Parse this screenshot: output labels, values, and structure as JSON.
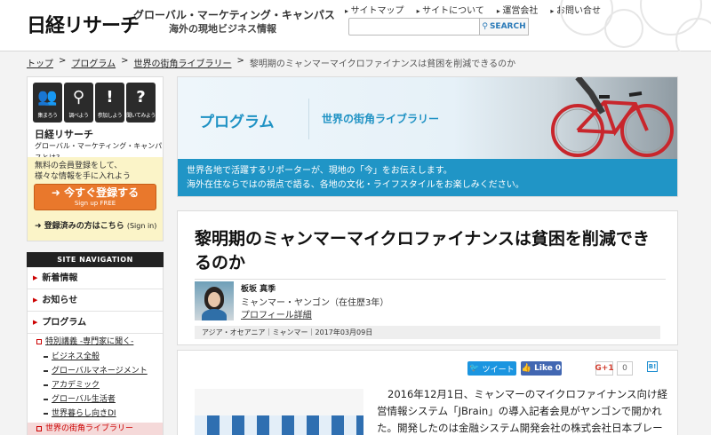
{
  "header": {
    "logo": "日経リサーチ",
    "tagline": "グローバル・マーケティング・キャンパス",
    "tagline_sub": "海外の現地ビジネス情報",
    "links": [
      "サイトマップ",
      "サイトについて",
      "運営会社",
      "お問い合せ"
    ],
    "search_placeholder": "",
    "search_button": "SEARCH"
  },
  "breadcrumb": [
    "トップ",
    "プログラム",
    "世界の街角ライブラリー",
    "黎明期のミャンマーマイクロファイナンスは貧困を削減できるのか"
  ],
  "sidebar": {
    "icons": [
      {
        "label": "集まろう",
        "glyph": "👥",
        "icon": "people-icon"
      },
      {
        "label": "調べよう",
        "glyph": "⚲",
        "icon": "magnifier-icon"
      },
      {
        "label": "参加しよう",
        "glyph": "!",
        "icon": "exclamation-icon"
      },
      {
        "label": "聞いてみよう",
        "glyph": "?",
        "icon": "question-icon"
      }
    ],
    "brand": "日経リサーチ",
    "brand_sub": "グローバル・マーケティング・キャンパスとは?",
    "note_line1": "無料の会員登録をして、",
    "note_line2": "様々な情報を手に入れよう",
    "register_label": "今すぐ登録する",
    "register_sub": "Sign up FREE",
    "signin": "登録済みの方はこちら",
    "signin_en": "(Sign in)"
  },
  "nav": {
    "header": "SITE NAVIGATION",
    "items": [
      "新着情報",
      "お知らせ",
      "プログラム"
    ],
    "sub": "特別講義 -専門家に聞く-",
    "sub_items": [
      "ビジネス全般",
      "グローバルマネージメント",
      "アカデミック",
      "グローバル生活者",
      "世界暮らし向きDI"
    ],
    "active": "世界の街角ライブラリー"
  },
  "banner": {
    "program": "プログラム",
    "library": "世界の街角ライブラリー",
    "desc_line1": "世界各地で活躍するリポーターが、現地の「今」をお伝えします。",
    "desc_line2": "海外在住ならではの視点で語る、各地の文化・ライフスタイルをお楽しみください。"
  },
  "article": {
    "title": "黎明期のミャンマーマイクロファイナンスは貧困を削減できるのか",
    "author": "板坂 真季",
    "location": "ミャンマー・ヤンゴン（在住歴3年）",
    "profile_link": "プロフィール詳細",
    "meta": "アジア・オセアニア｜ミャンマー｜2017年03月09日"
  },
  "social": {
    "tweet": "ツイート",
    "like": "Like",
    "like_count": "0",
    "gplus": "G+1",
    "gplus_count": "0",
    "hatena": "B!"
  },
  "body": {
    "text": "2016年12月1日、ミャンマーのマイクロファイナンス向け経営情報システム「JBrain」の導入記者会見がヤンゴンで開かれた。開発したのは金融システム開発会社の株式会社日本ブレー"
  },
  "colors": {
    "accent": "#1f92c4",
    "register": "#e9782c",
    "nav_active": "#c00000",
    "twitter": "#1b95e0",
    "facebook": "#4267b2"
  }
}
